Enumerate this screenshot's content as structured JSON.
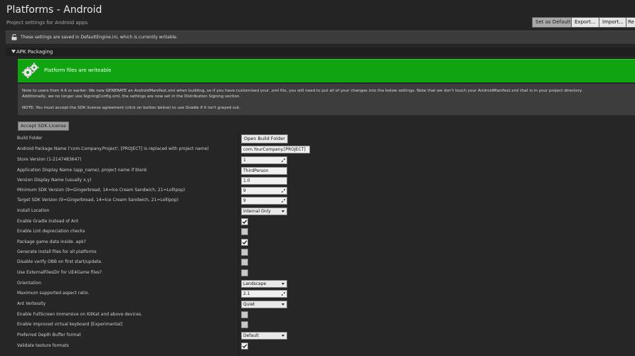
{
  "header": {
    "title": "Platforms - Android",
    "subtitle": "Project settings for Android apps",
    "buttons": {
      "set_default": "Set as Default",
      "export": "Export...",
      "import": "Import...",
      "reset": "Re"
    }
  },
  "notice": {
    "text": "These settings are saved in DefaultEngine.ini, which is currently writable."
  },
  "section": {
    "title": "APK Packaging"
  },
  "banner": {
    "text": "Platform files are writeable"
  },
  "info": {
    "line1": "Note to users from 4.6 or earlier: We now GENERATE an AndroidManifest.xml when building, so if you have customized your .xml file, you will need to put all of your changes into the below settings. Note that we don't touch your AndroidManifest.xml that is in your project directory.",
    "line2": "Additionally, we no longer use SigningConfig.xml, the settings are now set in the Distribution Signing section.",
    "line3": "NOTE: You must accept the SDK license agreement (click on button below) to use Gradle if it isn't grayed out."
  },
  "accept_label": "Accept SDK License",
  "rows": {
    "build_folder": {
      "label": "Build Folder",
      "button": "Open Build Folder"
    },
    "package_name": {
      "label": "Android Package Name ('com.Company.Project', [PROJECT] is replaced with project name)",
      "value": "com.YourCompany.[PROJECT]"
    },
    "store_version": {
      "label": "Store Version (1-2147483647)",
      "value": "1"
    },
    "app_display_name": {
      "label": "Application Display Name (app_name), project name if blank",
      "value": "ThirdPerson"
    },
    "version_display_name": {
      "label": "Version Display Name (usually x.y)",
      "value": "1.0"
    },
    "min_sdk": {
      "label": "Minimum SDK Version (9=Gingerbread, 14=Ice Cream Sandwich, 21=Lollipop)",
      "value": "9"
    },
    "target_sdk": {
      "label": "Target SDK Version (9=Gingerbread, 14=Ice Cream Sandwich, 21=Lollipop)",
      "value": "9"
    },
    "install_location": {
      "label": "Install Location",
      "value": "Internal Only"
    },
    "enable_gradle": {
      "label": "Enable Gradle instead of Ant",
      "checked": true
    },
    "lint": {
      "label": "Enable Lint depreciation checks",
      "checked": false
    },
    "package_data": {
      "label": "Package game data inside .apk?",
      "checked": true
    },
    "install_files": {
      "label": "Generate install files for all platforms",
      "checked": false
    },
    "verify_obb": {
      "label": "Disable verify OBB on first start/update.",
      "checked": false
    },
    "external_files": {
      "label": "Use ExternalFilesDir for UE4Game files?",
      "checked": false
    },
    "orientation": {
      "label": "Orientation",
      "value": "Landscape"
    },
    "aspect_ratio": {
      "label": "Maximum supported aspect ratio.",
      "value": "2.1"
    },
    "ant_verbosity": {
      "label": "Ant Verbosity",
      "value": "Quiet"
    },
    "fullscreen": {
      "label": "Enable FullScreen Immersive on KitKat and above devices.",
      "checked": false
    },
    "virtual_keyboard": {
      "label": "Enable improved virtual keyboard [Experimental]",
      "checked": false
    },
    "depth_buffer": {
      "label": "Preferred Depth Buffer format",
      "value": "Default"
    },
    "validate_textures": {
      "label": "Validate texture formats",
      "checked": true
    }
  },
  "colors": {
    "banner": "#10a510",
    "background": "#262626"
  }
}
